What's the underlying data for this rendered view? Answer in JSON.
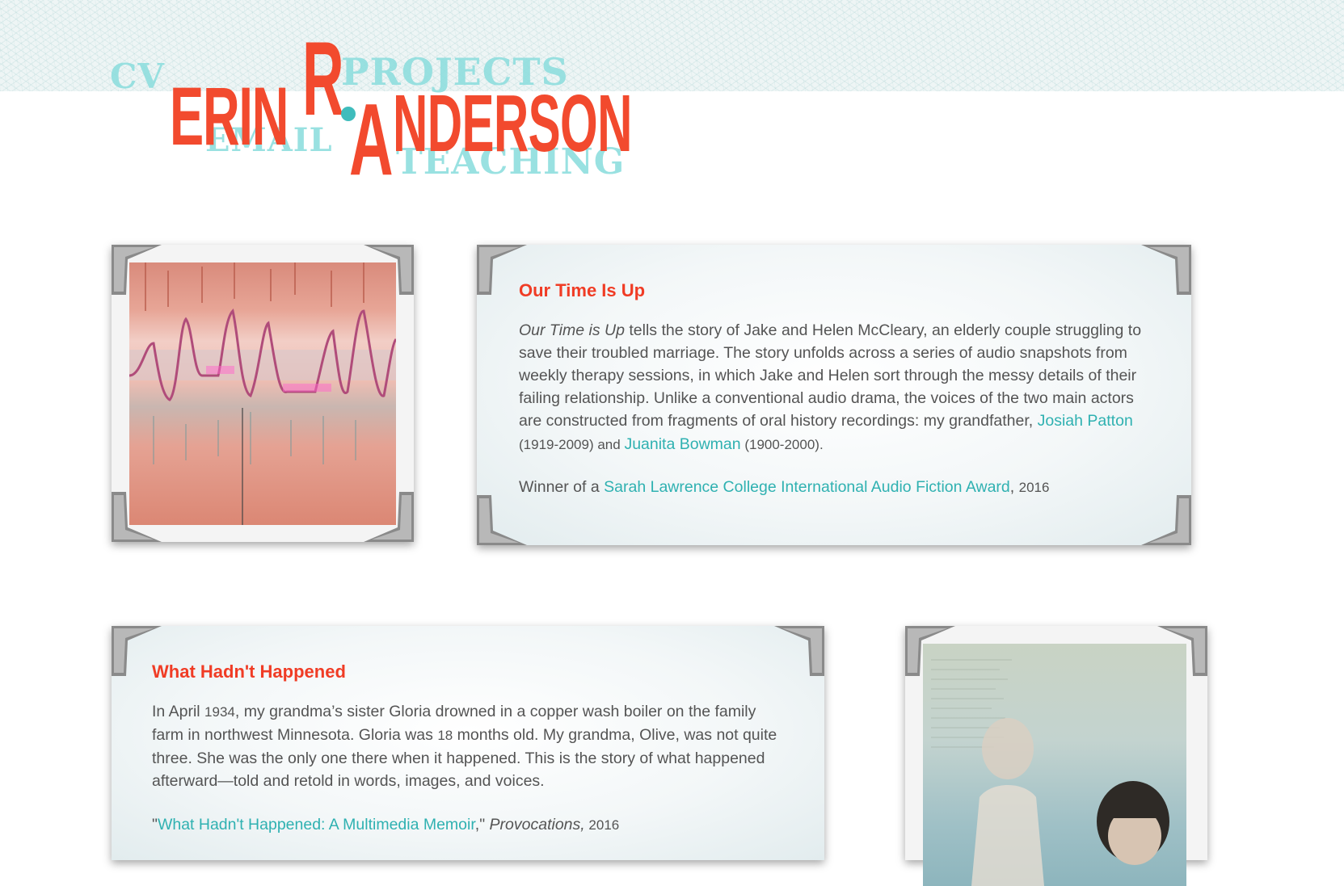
{
  "header": {
    "name": {
      "first": "ERIN",
      "initial": "R",
      "last_first": "A",
      "last_rest": "NDERSON"
    },
    "nav": {
      "cv": "CV",
      "projects": "PROJECTS",
      "email": "EMAIL",
      "teaching": "TEACHING"
    }
  },
  "projects": [
    {
      "title": "Our Time Is Up",
      "title_italic": "Our Time is Up",
      "desc": " tells the story of Jake and Helen McCleary, an elderly couple struggling to save their troubled marriage. The story unfolds across a series of audio snapshots from weekly therapy sessions, in which Jake and Helen sort through the messy details of their failing relationship. Unlike a conventional audio drama, the voices of the two main actors are constructed from fragments of oral history recordings: my grandfather, ",
      "link1": "Josiah Patton",
      "dates1": " (1919-2009) and ",
      "link2": "Juanita Bowman",
      "dates2": " (1900-2000).",
      "award_prefix": "Winner of a ",
      "award_link": "Sarah Lawrence College International Audio Fiction Award",
      "award_sep": ", ",
      "award_year": "2016"
    },
    {
      "title": "What Hadn't Happened",
      "desc_a": "In April ",
      "year": "1934",
      "desc_b": ", my grandma’s sister Gloria drowned in a copper wash boiler on the family farm in northwest Minnesota. Gloria was ",
      "months": "18",
      "desc_c": " months old. My grandma, Olive, was not quite three. She was the only one there when it happened. This is the story of what happened afterward—told and retold in words, images, and voices.",
      "cite_open": "\"",
      "cite_link": "What Hadn't Happened: A Multimedia Memoir",
      "cite_close": ",\" ",
      "cite_journal": "Provocations,",
      "cite_year": " 2016"
    }
  ],
  "colors": {
    "accent_red": "#f03c25",
    "link_teal": "#2fb1b1",
    "nav_teal": "#8fdede"
  },
  "icons": [
    "photo-corner-icon"
  ]
}
